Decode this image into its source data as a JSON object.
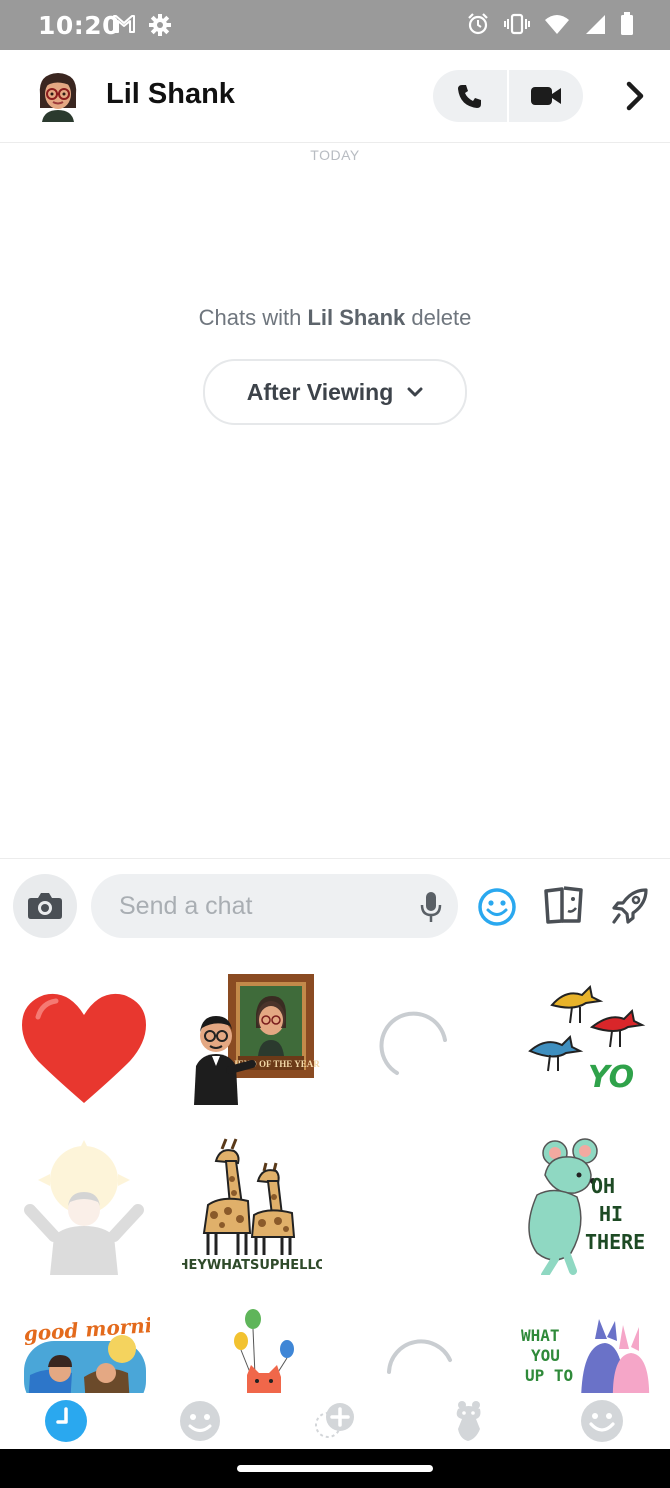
{
  "status_bar": {
    "time": "10:20"
  },
  "header": {
    "name": "Lil Shank"
  },
  "conversation": {
    "date_label": "TODAY",
    "delete_prefix": "Chats with ",
    "delete_name": "Lil Shank",
    "delete_suffix": " delete",
    "delete_option": "After Viewing"
  },
  "input": {
    "placeholder": "Send a chat"
  },
  "stickers": {
    "friend_of_year": "FRIEND OF THE YEAR",
    "yo": "YO",
    "hey_whats_up": "HEYWHATSUPHELLO",
    "oh_hi_there": [
      "OH",
      "HI",
      "THERE"
    ],
    "good_morning": "good morning!",
    "what_you_up_to": [
      "WHAT",
      "YOU",
      "UP TO"
    ]
  },
  "colors": {
    "status_bar": "#9a9a9a",
    "accent_blue": "#2aa8ef",
    "pill_bg": "#eef0f2",
    "heart_red": "#e8372f"
  }
}
